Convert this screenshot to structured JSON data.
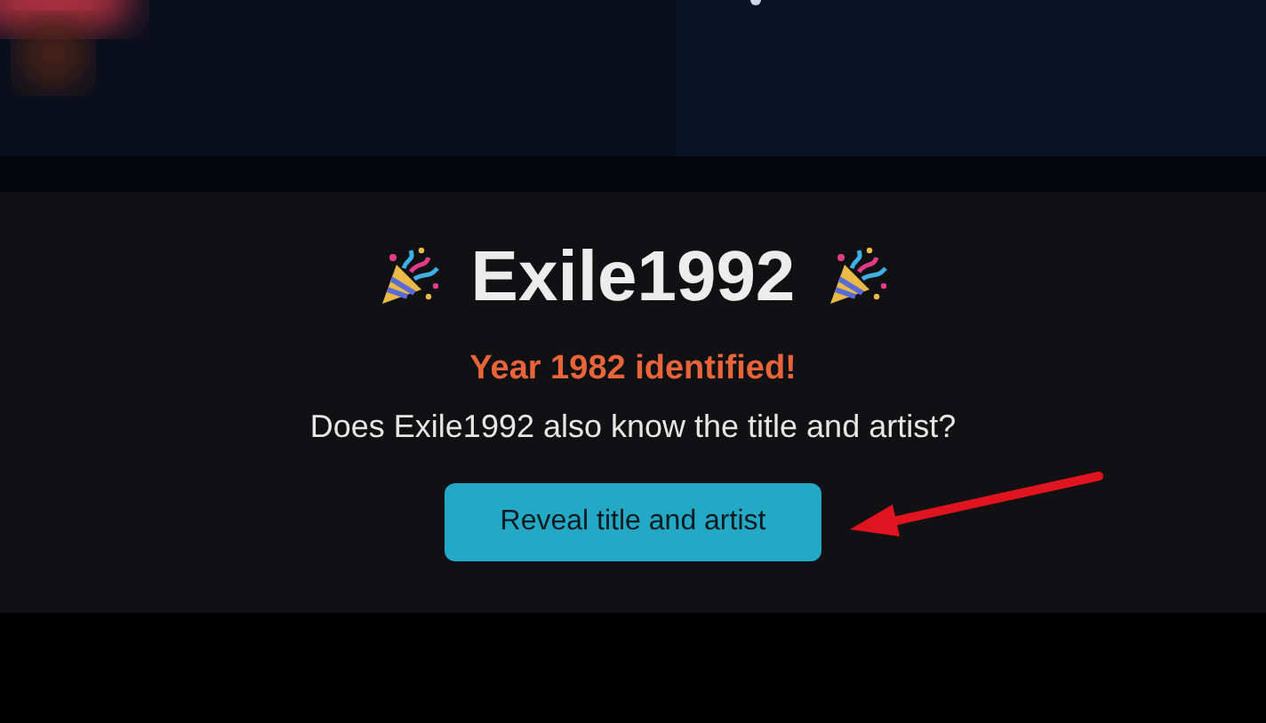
{
  "player": {
    "name": "Exile1992",
    "status": "Year 1982 identified!",
    "question": "Does Exile1992 also know the title and artist?",
    "button": "Reveal title and artist"
  }
}
